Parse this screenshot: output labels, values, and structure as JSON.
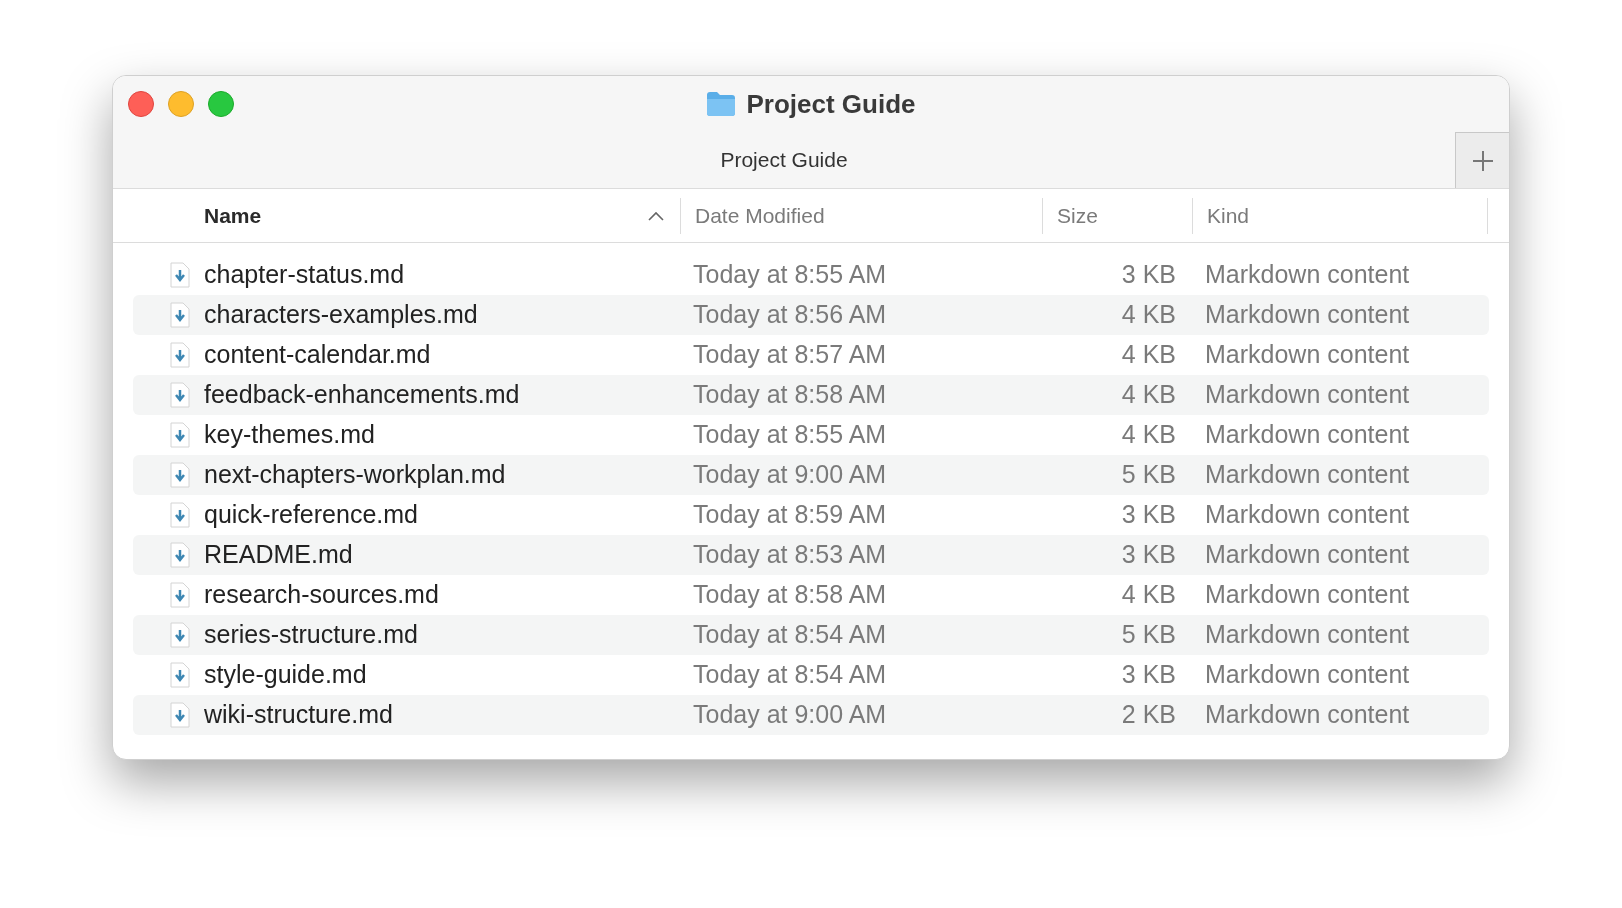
{
  "window": {
    "title": "Project Guide"
  },
  "tabs": [
    {
      "label": "Project Guide",
      "selected": true
    }
  ],
  "table": {
    "columns": [
      {
        "label": "Name",
        "sorted": true
      },
      {
        "label": "Date Modified",
        "sorted": false
      },
      {
        "label": "Size",
        "sorted": false
      },
      {
        "label": "Kind",
        "sorted": false
      }
    ],
    "rows": [
      {
        "name": "chapter-status.md",
        "date": "Today at 8:55 AM",
        "size": "3 KB",
        "kind": "Markdown content"
      },
      {
        "name": "characters-examples.md",
        "date": "Today at 8:56 AM",
        "size": "4 KB",
        "kind": "Markdown content"
      },
      {
        "name": "content-calendar.md",
        "date": "Today at 8:57 AM",
        "size": "4 KB",
        "kind": "Markdown content"
      },
      {
        "name": "feedback-enhancements.md",
        "date": "Today at 8:58 AM",
        "size": "4 KB",
        "kind": "Markdown content"
      },
      {
        "name": "key-themes.md",
        "date": "Today at 8:55 AM",
        "size": "4 KB",
        "kind": "Markdown content"
      },
      {
        "name": "next-chapters-workplan.md",
        "date": "Today at 9:00 AM",
        "size": "5 KB",
        "kind": "Markdown content"
      },
      {
        "name": "quick-reference.md",
        "date": "Today at 8:59 AM",
        "size": "3 KB",
        "kind": "Markdown content"
      },
      {
        "name": "README.md",
        "date": "Today at 8:53 AM",
        "size": "3 KB",
        "kind": "Markdown content"
      },
      {
        "name": "research-sources.md",
        "date": "Today at 8:58 AM",
        "size": "4 KB",
        "kind": "Markdown content"
      },
      {
        "name": "series-structure.md",
        "date": "Today at 8:54 AM",
        "size": "5 KB",
        "kind": "Markdown content"
      },
      {
        "name": "style-guide.md",
        "date": "Today at 8:54 AM",
        "size": "3 KB",
        "kind": "Markdown content"
      },
      {
        "name": "wiki-structure.md",
        "date": "Today at 9:00 AM",
        "size": "2 KB",
        "kind": "Markdown content"
      }
    ]
  }
}
